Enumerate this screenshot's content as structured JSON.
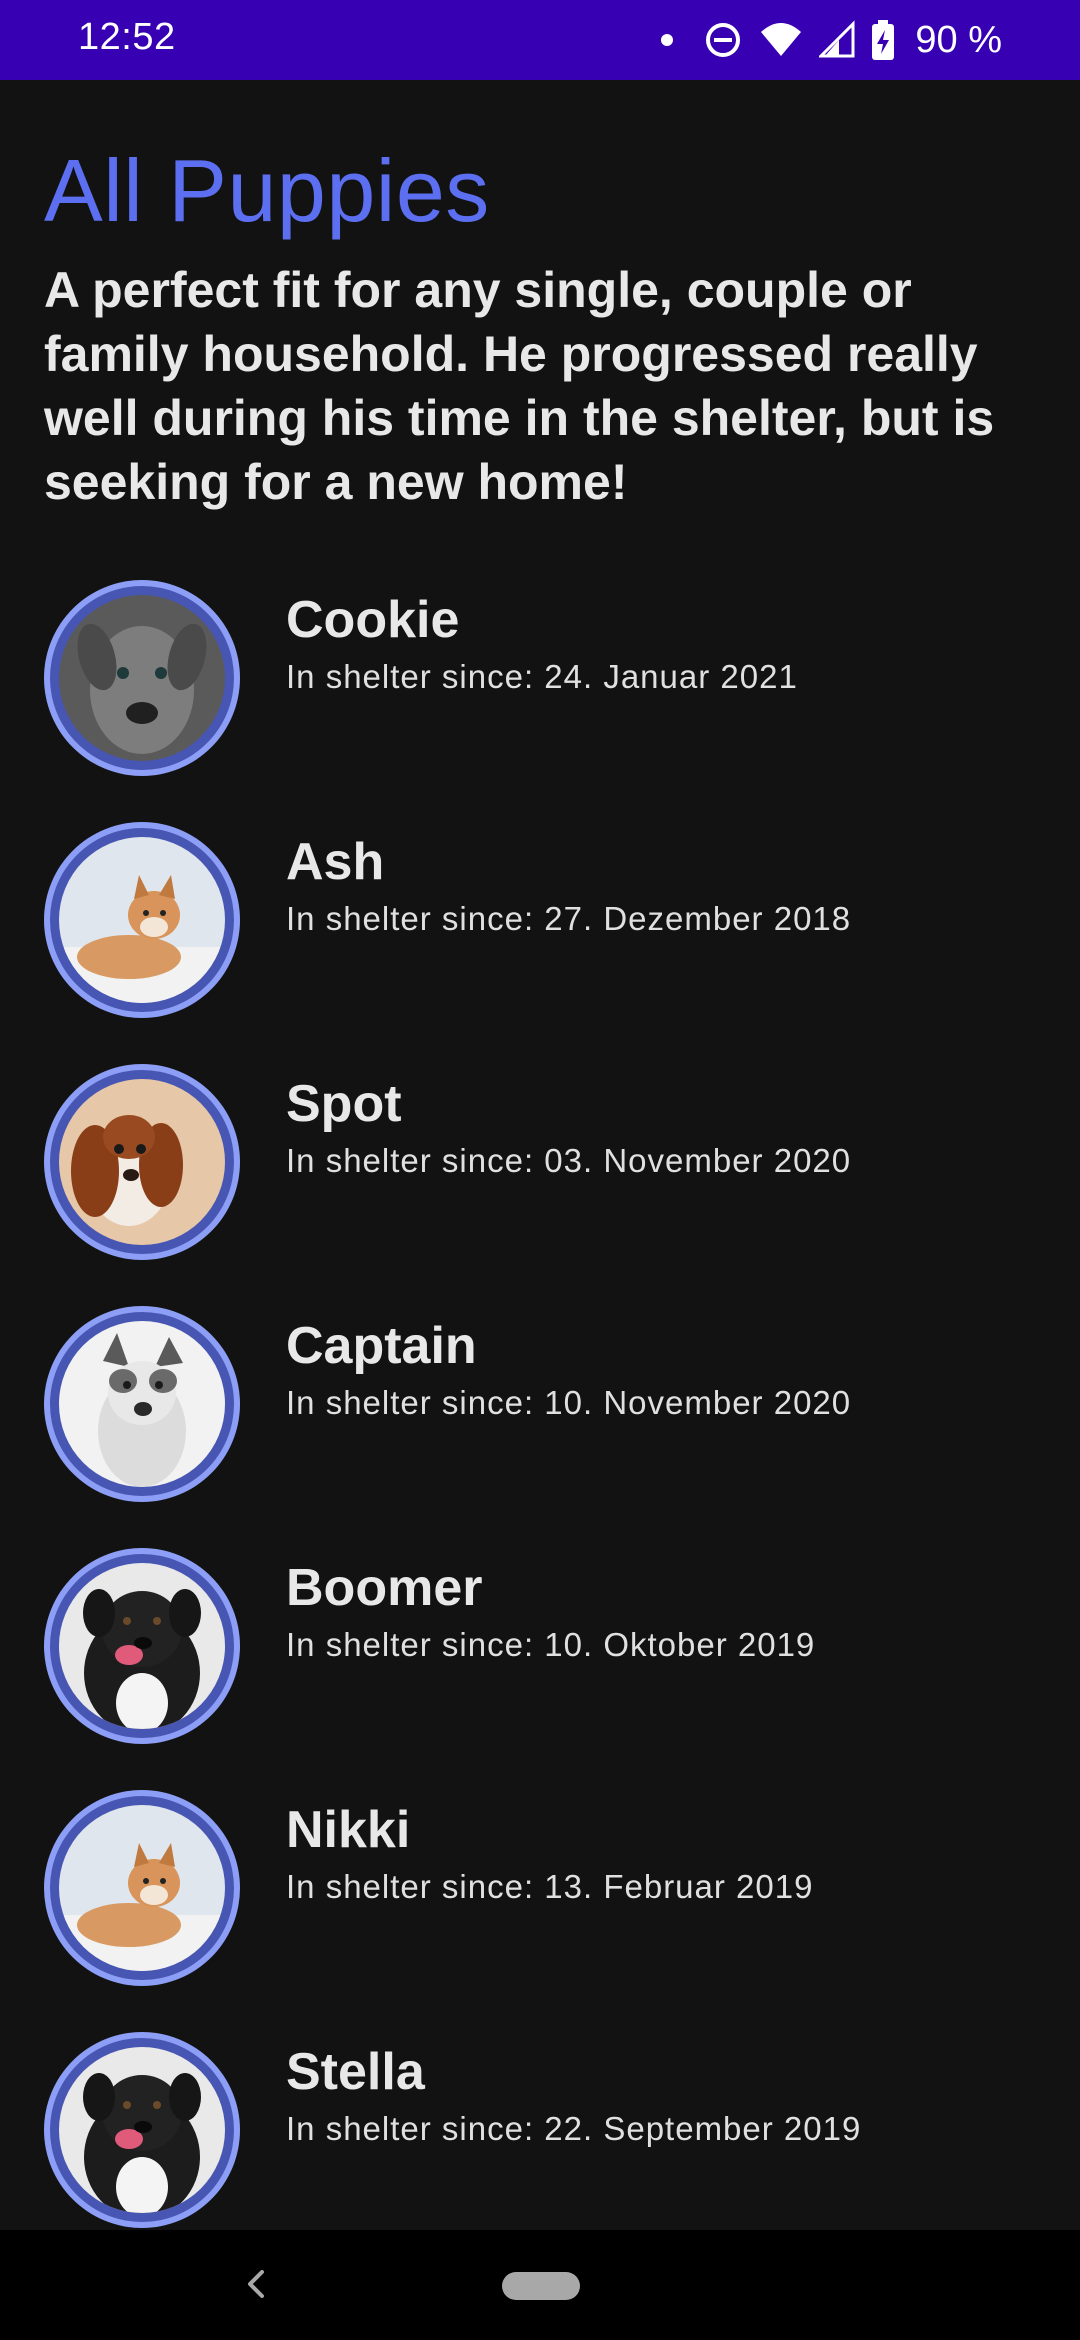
{
  "status_bar": {
    "time": "12:52",
    "battery_percent": "90 %",
    "icons": [
      "notification-dot-icon",
      "do-not-disturb-icon",
      "wifi-icon",
      "cell-signal-icon",
      "battery-charging-icon"
    ]
  },
  "header": {
    "title": "All Puppies",
    "description": "A perfect fit for any single, couple or family household. He progressed really well during his time in the shelter, but is seeking for a new home!"
  },
  "puppies": [
    {
      "name": "Cookie",
      "since": "In shelter since: 24. Januar 2021",
      "photo": "gray-dog-photo"
    },
    {
      "name": "Ash",
      "since": "In shelter since: 27. Dezember 2018",
      "photo": "shiba-photo"
    },
    {
      "name": "Spot",
      "since": "In shelter since: 03. November 2020",
      "photo": "spaniel-photo"
    },
    {
      "name": "Captain",
      "since": "In shelter since: 10. November 2020",
      "photo": "bw-dog-photo"
    },
    {
      "name": "Boomer",
      "since": "In shelter since: 10. Oktober 2019",
      "photo": "black-dog-photo"
    },
    {
      "name": "Nikki",
      "since": "In shelter since: 13. Februar 2019",
      "photo": "shiba-photo"
    },
    {
      "name": "Stella",
      "since": "In shelter since: 22. September 2019",
      "photo": "black-dog-photo"
    }
  ],
  "nav_bar": {
    "icons": [
      "back-icon",
      "home-pill-icon"
    ]
  },
  "colors": {
    "status_bar": "#3700b3",
    "title": "#5c6ff0",
    "avatar_ring": "#8c9ef5",
    "background": "#121212"
  }
}
